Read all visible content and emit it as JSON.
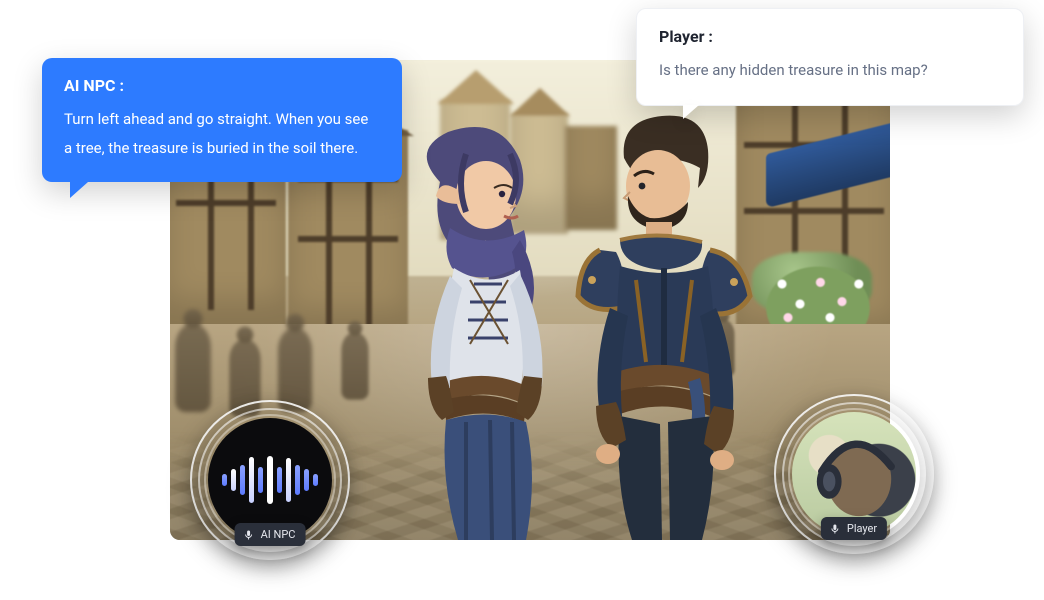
{
  "npc_bubble": {
    "speaker": "AI NPC :",
    "text": "Turn left ahead and go straight. When you see a tree, the treasure is buried in the soil there."
  },
  "player_bubble": {
    "speaker": "Player :",
    "text": "Is there any hidden treasure in this map?"
  },
  "voice_pills": {
    "npc": "AI NPC",
    "player": "Player"
  },
  "colors": {
    "npc_bubble_bg": "#2D7BFF",
    "player_bubble_bg": "#FFFFFF"
  }
}
